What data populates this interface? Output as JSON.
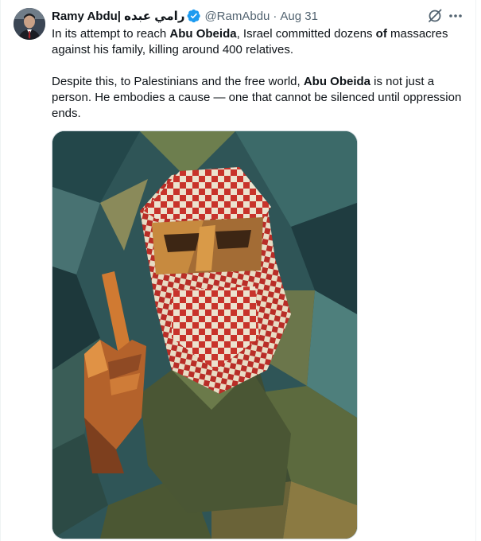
{
  "tweet": {
    "author": {
      "display_name": "Ramy Abdu| رامي عبده",
      "handle": "@RamAbdu",
      "verified": true,
      "avatar": "profile-photo"
    },
    "separator": "·",
    "timestamp": "Aug 31",
    "icons": {
      "grok": "grok-icon",
      "more": "more-icon",
      "verified": "verified-badge-icon"
    },
    "text": {
      "p1_a": "In its attempt to reach ",
      "p1_b": "Abu Obeida",
      "p1_c": ", Israel committed dozens ",
      "p1_d": "of",
      "p1_e": " massacres against his family, killing around 400 relatives.",
      "p2_a": "Despite this, to Palestinians and the free world, ",
      "p2_b": "Abu Obeida",
      "p2_c": " is not just a person. He embodies a cause — one that cannot be silenced until oppression ends."
    },
    "media": {
      "type": "image",
      "subject": "cubist-painting-masked-figure-keffiyeh-raised-finger"
    }
  },
  "colors": {
    "text_primary": "#0f1419",
    "text_secondary": "#536471",
    "verified_blue": "#1d9bf0",
    "border": "#cfd9de",
    "keffiyeh_red": "#c8332b"
  }
}
